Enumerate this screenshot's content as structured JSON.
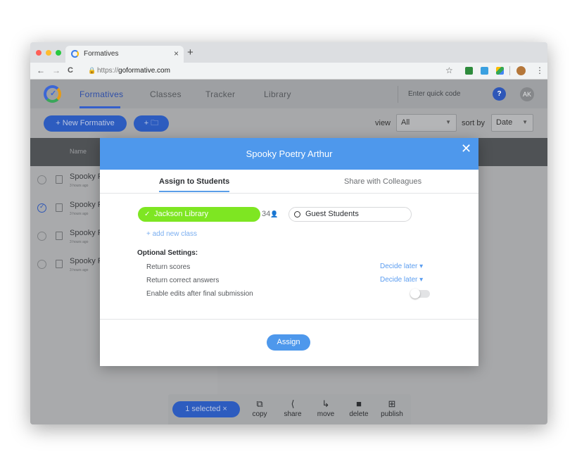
{
  "browser": {
    "tab_title": "Formatives",
    "tab_close": "×",
    "new_tab": "+",
    "url_scheme": "https://",
    "url_host": "goformative.com",
    "back": "←",
    "forward": "→",
    "reload": "C",
    "menu": "⋮",
    "star": "☆",
    "lock": "🔒"
  },
  "app": {
    "nav": [
      "Formatives",
      "Classes",
      "Tracker",
      "Library"
    ],
    "quick_code_placeholder": "Enter quick code",
    "help": "?",
    "avatar": "AK",
    "new_formative": "+ New Formative",
    "new_folder": "+ 🗀",
    "view_label": "view",
    "view_value": "All",
    "sort_label": "sort by",
    "sort_value": "Date",
    "column_name": "Name",
    "rows": [
      {
        "title": "Spooky P",
        "sub": "3 hours ago",
        "checked": false
      },
      {
        "title": "Spooky P",
        "sub": "3 hours ago",
        "checked": true
      },
      {
        "title": "Spooky P",
        "sub": "3 hours ago",
        "checked": false
      },
      {
        "title": "Spooky P",
        "sub": "3 hours ago",
        "checked": false
      }
    ],
    "actionbar": {
      "selected": "1 selected  ×",
      "actions": [
        {
          "icon": "⧉",
          "label": "copy"
        },
        {
          "icon": "⟨",
          "label": "share"
        },
        {
          "icon": "↳",
          "label": "move"
        },
        {
          "icon": "■",
          "label": "delete"
        },
        {
          "icon": "⊞",
          "label": "publish"
        }
      ]
    }
  },
  "modal": {
    "title": "Spooky Poetry Arthur",
    "close": "✕",
    "tabs": [
      "Assign to Students",
      "Share with Colleagues"
    ],
    "class_name": "Jackson Library",
    "class_count": "34",
    "guest_label": "Guest Students",
    "add_class": "+ add new class",
    "optional_heading": "Optional Settings:",
    "settings": [
      {
        "label": "Return scores",
        "value": "Decide later ▾"
      },
      {
        "label": "Return correct answers",
        "value": "Decide later ▾"
      },
      {
        "label": "Enable edits after final submission",
        "value": ""
      }
    ],
    "assign_label": "Assign"
  },
  "colors": {
    "modal_accent": "#4e98ec",
    "class_pill": "#7ee622",
    "brand_blue": "#2d5cbf"
  }
}
